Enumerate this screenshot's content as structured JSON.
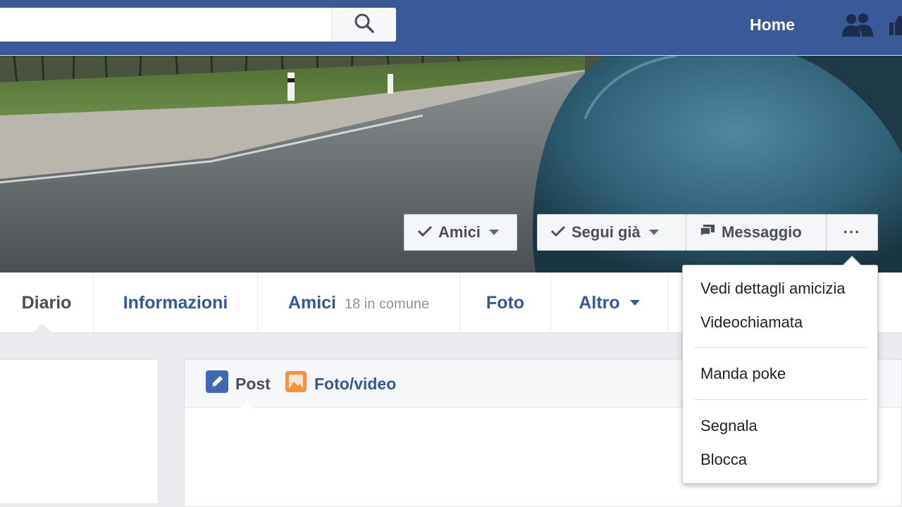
{
  "header": {
    "search_placeholder": "",
    "home_label": "Home",
    "icons": [
      "search-icon",
      "friends-icon",
      "like-icon"
    ]
  },
  "cover_actions": {
    "friends_label": "Amici",
    "follow_label": "Segui già",
    "message_label": "Messaggio",
    "more_label": "···"
  },
  "timeline_nav": {
    "diario": "Diario",
    "informazioni": "Informazioni",
    "amici": "Amici",
    "amici_sub": "18 in comune",
    "foto": "Foto",
    "altro": "Altro"
  },
  "composer": {
    "post_label": "Post",
    "photo_label": "Foto/video"
  },
  "dropdown": {
    "items": [
      {
        "label": "Vedi dettagli amicizia"
      },
      {
        "label": "Videochiamata"
      },
      {
        "label": "Manda poke"
      },
      {
        "label": "Segnala"
      },
      {
        "label": "Blocca"
      }
    ]
  },
  "colors": {
    "brand": "#3b5998",
    "link": "#365899",
    "background": "#e9ebee"
  }
}
